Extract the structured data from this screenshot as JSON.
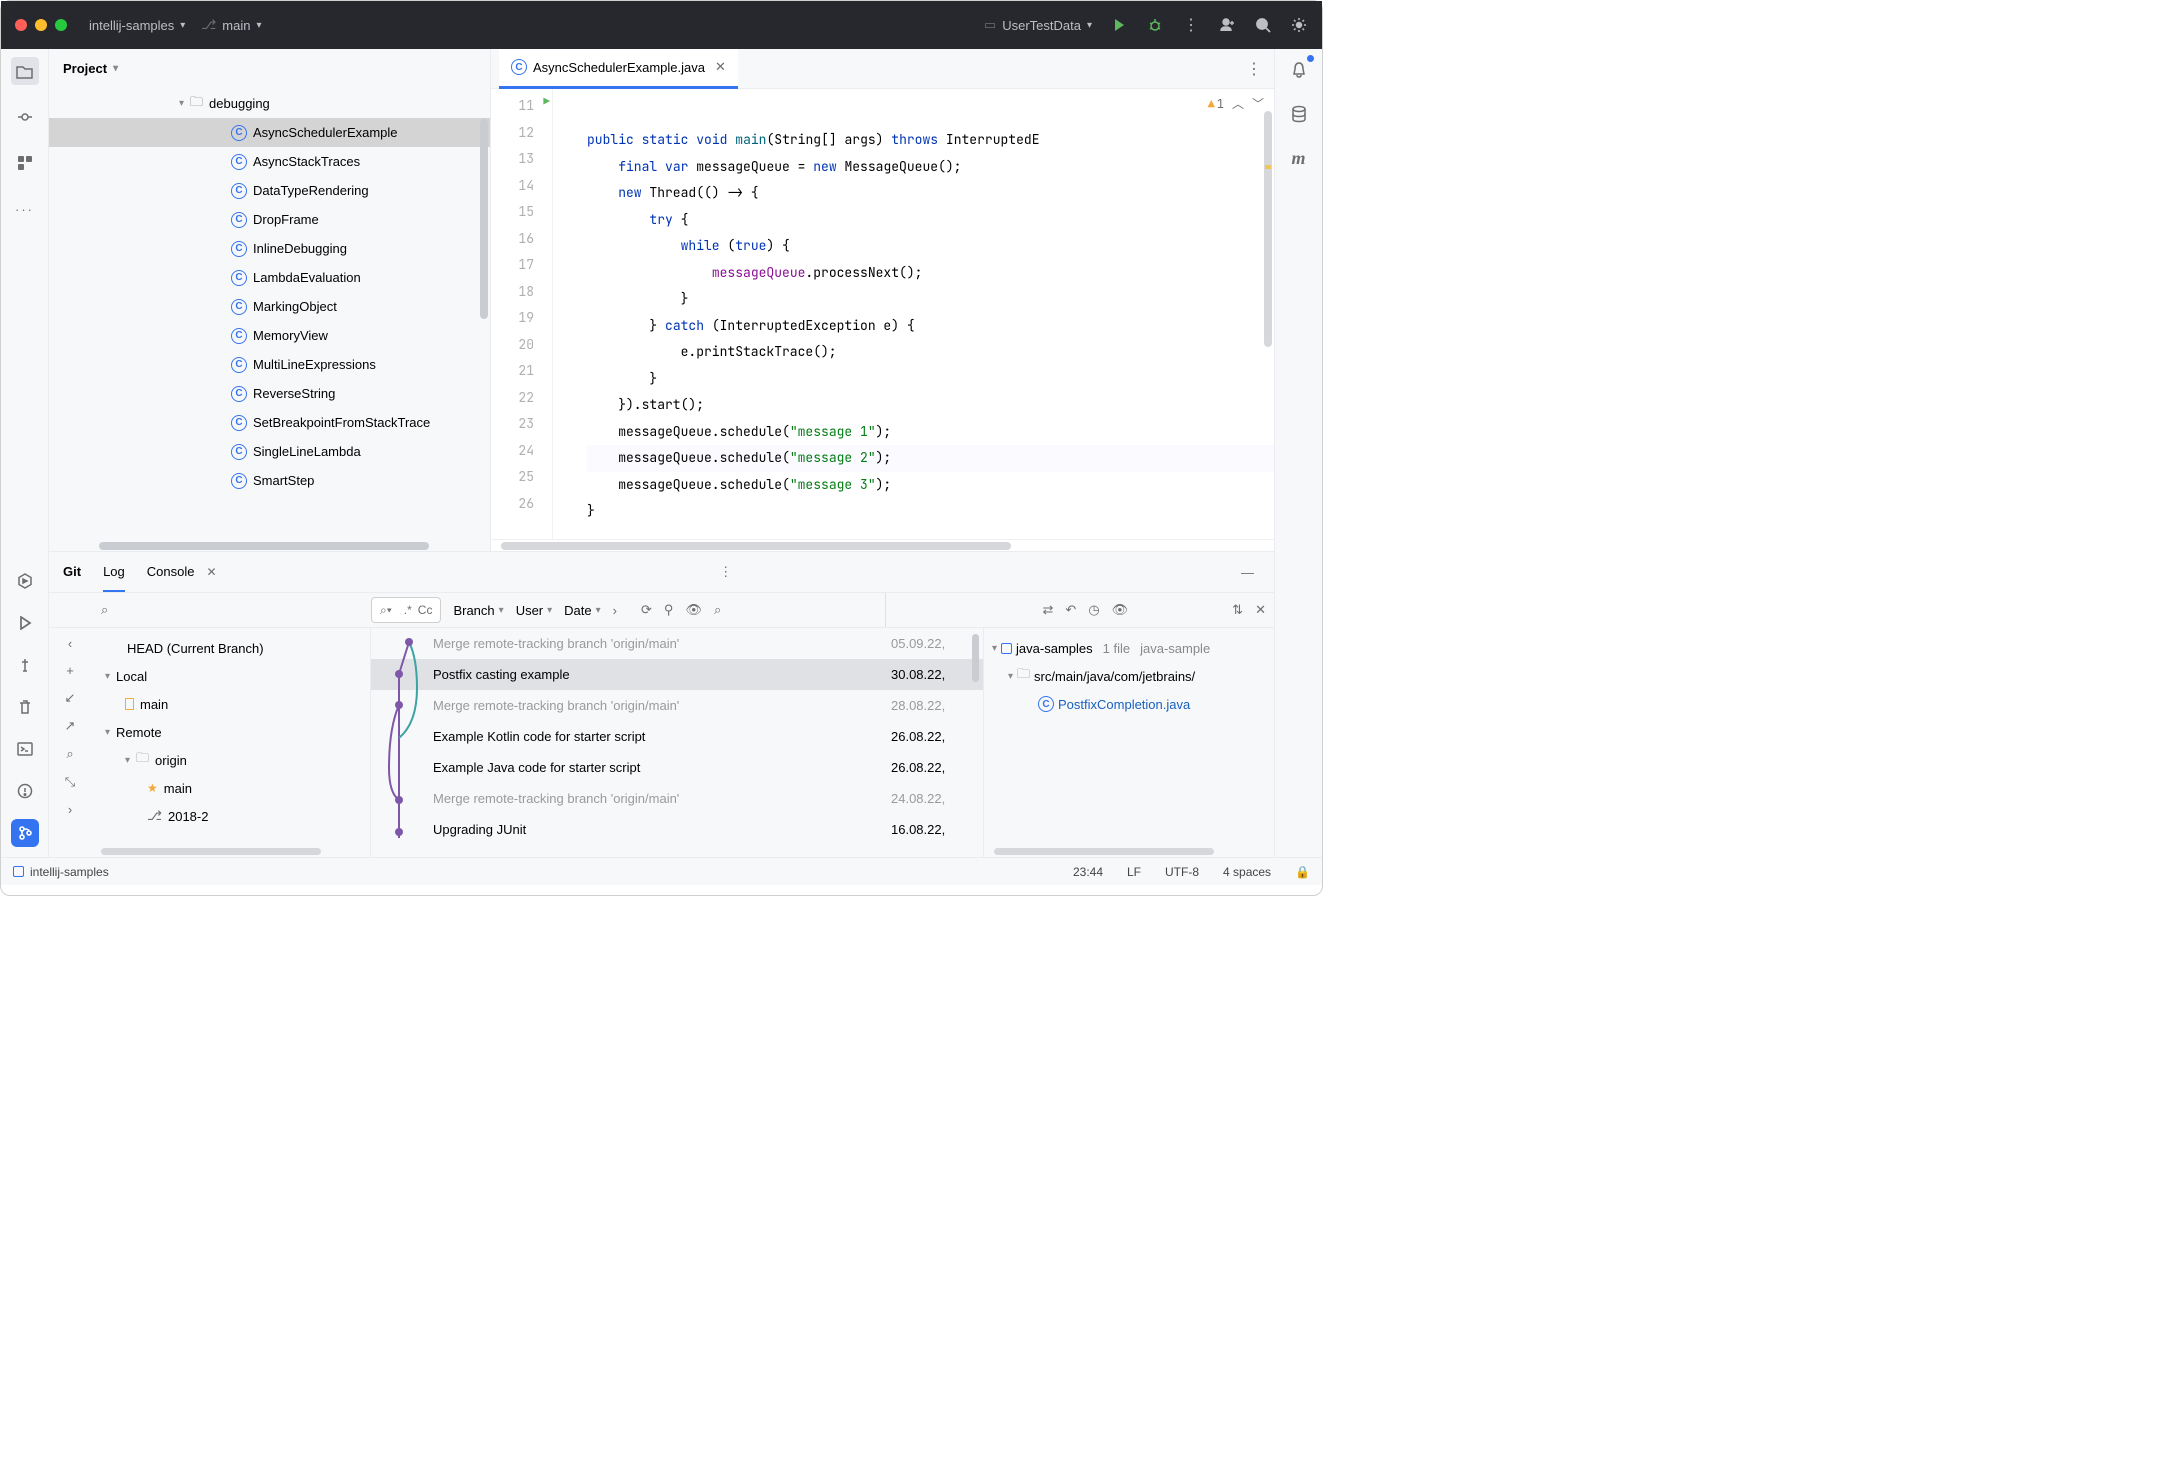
{
  "titlebar": {
    "project_name": "intellij-samples",
    "branch": "main",
    "run_config": "UserTestData"
  },
  "project_tool": {
    "title": "Project",
    "folder": "debugging",
    "files": [
      "AsyncSchedulerExample",
      "AsyncStackTraces",
      "DataTypeRendering",
      "DropFrame",
      "InlineDebugging",
      "LambdaEvaluation",
      "MarkingObject",
      "MemoryView",
      "MultiLineExpressions",
      "ReverseString",
      "SetBreakpointFromStackTrace",
      "SingleLineLambda",
      "SmartStep"
    ],
    "selected_index": 0
  },
  "tabs": [
    {
      "label": "AsyncSchedulerExample.java"
    }
  ],
  "editor": {
    "first_line": 11,
    "warning_count": "1",
    "lines": [
      "<span class='kw'>public</span> <span class='kw'>static</span> <span class='kw'>void</span> <span class='fn'>main</span>(String[] args) <span class='kw'>throws</span> InterruptedE",
      "    <span class='kw'>final</span> <span class='kw'>var</span> messageQueue = <span class='kw'>new</span> MessageQueue();",
      "    <span class='kw'>new</span> Thread(() -> {",
      "        <span class='kw'>try</span> {",
      "            <span class='kw'>while</span> (<span class='kw'>true</span>) {",
      "                <span class='fld'>messageQueue</span>.processNext();",
      "            }",
      "        } <span class='kw'>catch</span> (InterruptedException e) {",
      "            e.printStackTrace();",
      "        }",
      "    }).start();",
      "    messageQueue.schedule(<span class='str'>\"message 1\"</span>);",
      "    messageQueue.schedule(<span class='str'>\"message 2\"</span>);",
      "    messageQueue.schedule(<span class='str'>\"message 3\"</span>);",
      "}",
      ""
    ],
    "current_line_index": 12
  },
  "bottom": {
    "tabs": [
      "Git",
      "Log",
      "Console"
    ],
    "active_index": 1,
    "filter_regexp": ".*",
    "filter_cc": "Cc",
    "dropdowns": [
      "Branch",
      "User",
      "Date"
    ],
    "branches": {
      "head": "HEAD (Current Branch)",
      "local_label": "Local",
      "remote_label": "Remote",
      "origin_label": "origin",
      "local": [
        "main"
      ],
      "remote": [
        "main",
        "2018-2"
      ]
    },
    "commits": [
      {
        "msg": "Merge remote-tracking branch 'origin/main'",
        "date": "05.09.22,",
        "merge": true
      },
      {
        "msg": "Postfix casting example",
        "date": "30.08.22,",
        "merge": false,
        "selected": true
      },
      {
        "msg": "Merge remote-tracking branch 'origin/main'",
        "date": "28.08.22,",
        "merge": true
      },
      {
        "msg": "Example Kotlin code for starter script",
        "date": "26.08.22,",
        "merge": false
      },
      {
        "msg": "Example Java code for starter script",
        "date": "26.08.22,",
        "merge": false
      },
      {
        "msg": "Merge remote-tracking branch 'origin/main'",
        "date": "24.08.22,",
        "merge": true
      },
      {
        "msg": "Upgrading JUnit",
        "date": "16.08.22,",
        "merge": false
      }
    ],
    "files": {
      "root": "java-samples",
      "root_tail": "1 file",
      "root_tail2": "java-sample",
      "path": "src/main/java/com/jetbrains/",
      "changed_file": "PostfixCompletion.java"
    }
  },
  "statusbar": {
    "project": "intellij-samples",
    "time": "23:44",
    "line_sep": "LF",
    "encoding": "UTF-8",
    "indent": "4 spaces"
  }
}
